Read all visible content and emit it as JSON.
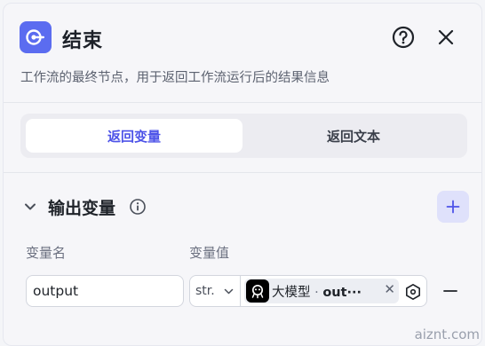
{
  "header": {
    "title": "结束",
    "description": "工作流的最终节点，用于返回工作流运行后的结果信息"
  },
  "tabs": [
    {
      "label": "返回变量",
      "active": true
    },
    {
      "label": "返回文本",
      "active": false
    }
  ],
  "output_section": {
    "title": "输出变量",
    "columns": {
      "name": "变量名",
      "value": "变量值"
    },
    "rows": [
      {
        "name": "output",
        "type": "str.",
        "ref_node": "大模型",
        "ref_separator": "·",
        "ref_var": "out···"
      }
    ]
  },
  "watermark": "aiznt.com",
  "colors": {
    "accent": "#4d53e8",
    "node_icon_bg": "#5b6cf0",
    "add_btn_bg": "#dfe1fb"
  },
  "icons": {
    "app": "end-node-icon",
    "help": "help-circle-icon",
    "close": "close-icon",
    "collapse": "chevron-down-icon",
    "info": "info-icon",
    "add": "plus-icon",
    "ref": "llm-node-icon",
    "picker": "hexagon-variable-icon",
    "remove": "minus-icon"
  }
}
